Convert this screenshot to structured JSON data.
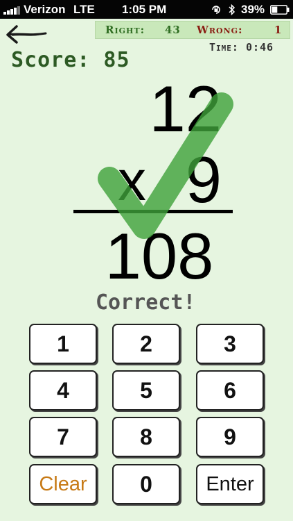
{
  "status_bar": {
    "carrier": "Verizon",
    "network": "LTE",
    "time": "1:05 PM",
    "battery": "39%",
    "icons": [
      "signal-bars-icon",
      "rotation-lock-icon",
      "bluetooth-icon",
      "battery-icon"
    ]
  },
  "tally": {
    "right_label": "Right:",
    "right_value": "43",
    "wrong_label": "Wrong:",
    "wrong_value": "1",
    "right_color": "#2f6d22",
    "wrong_color": "#8a1e13"
  },
  "timer": "Time: 0:46",
  "score": "Score: 85",
  "problem": {
    "top": "12",
    "operator": "x",
    "bottom": "9",
    "answer": "108"
  },
  "feedback": "Correct!",
  "check_color": "#3ea13a",
  "keypad": {
    "k1": "1",
    "k2": "2",
    "k3": "3",
    "k4": "4",
    "k5": "5",
    "k6": "6",
    "k7": "7",
    "k8": "8",
    "k9": "9",
    "clear": "Clear",
    "k0": "0",
    "enter": "Enter",
    "clear_color": "#c77a16"
  }
}
